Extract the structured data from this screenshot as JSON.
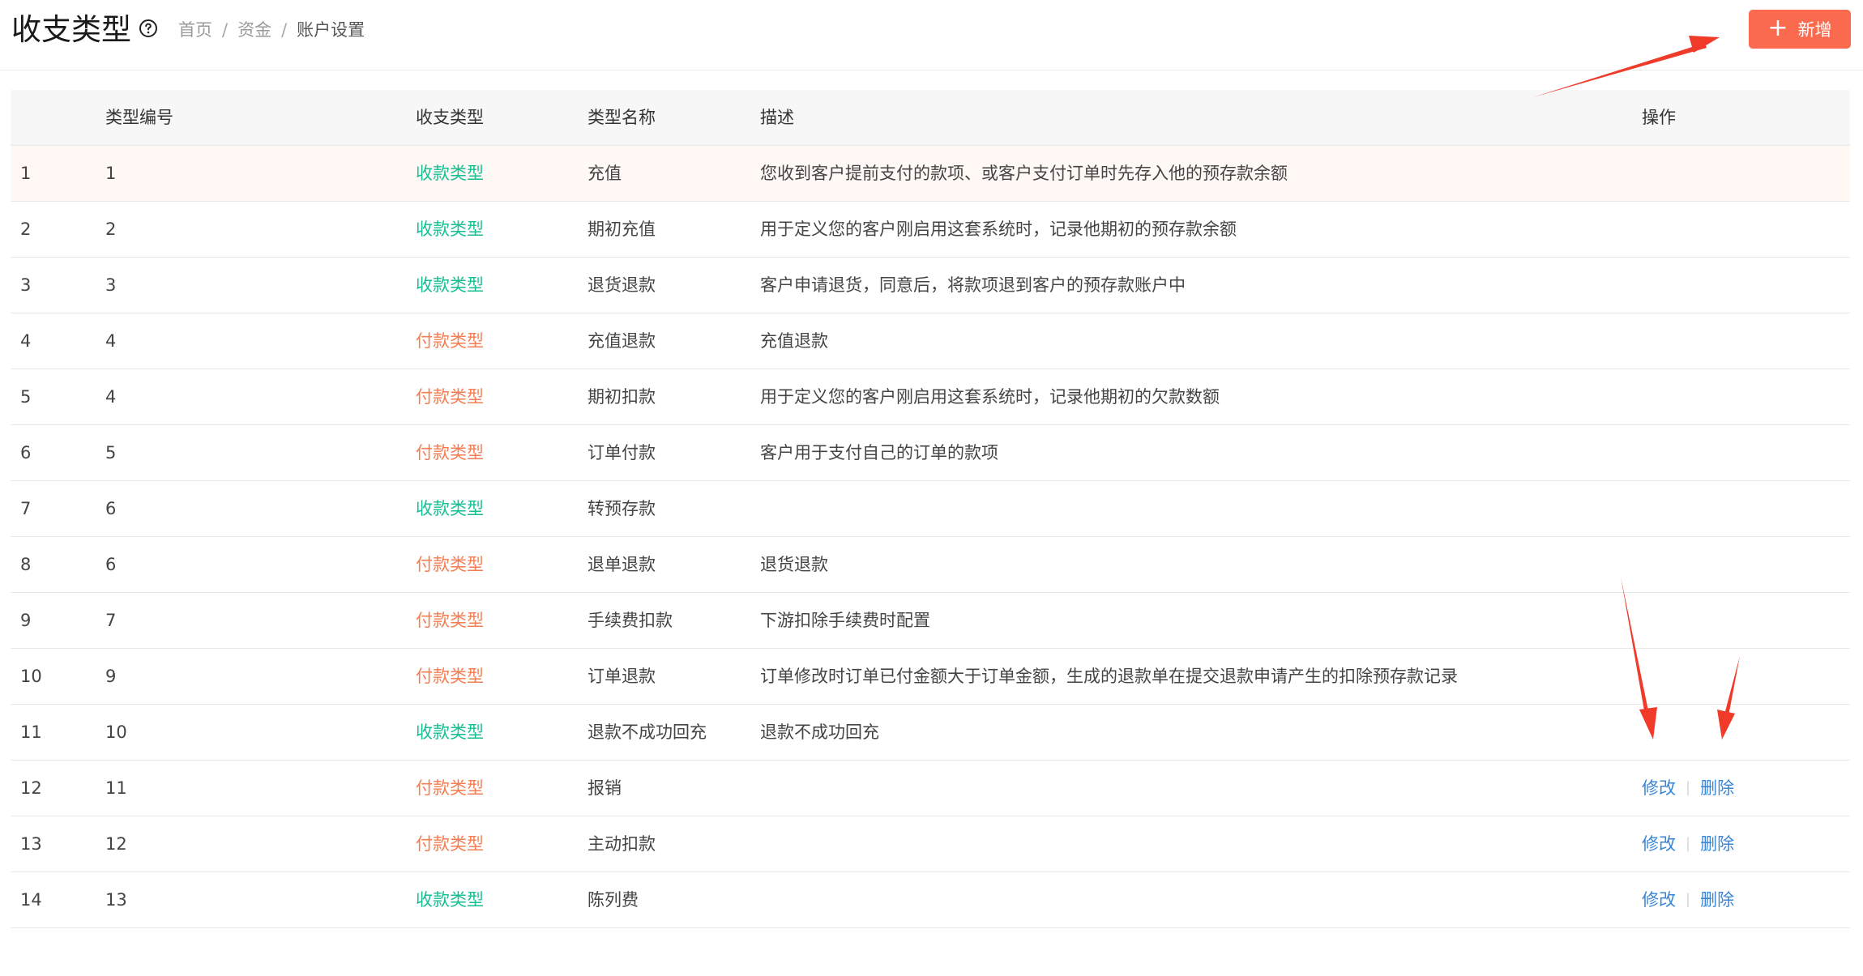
{
  "header": {
    "title": "收支类型",
    "breadcrumb": [
      "首页",
      "资金",
      "账户设置"
    ],
    "breadcrumb_separator": "/",
    "add_button_label": "新增",
    "add_button_color": "#fa6a4f"
  },
  "table": {
    "columns": [
      "",
      "类型编号",
      "收支类型",
      "类型名称",
      "描述",
      "操作"
    ],
    "rows": [
      {
        "index": "1",
        "code": "1",
        "type": "收款类型",
        "kind": "income",
        "name": "充值",
        "desc": "您收到客户提前支付的款项、或客户支付订单时先存入他的预存款余额",
        "ops": []
      },
      {
        "index": "2",
        "code": "2",
        "type": "收款类型",
        "kind": "income",
        "name": "期初充值",
        "desc": "用于定义您的客户刚启用这套系统时，记录他期初的预存款余额",
        "ops": []
      },
      {
        "index": "3",
        "code": "3",
        "type": "收款类型",
        "kind": "income",
        "name": "退货退款",
        "desc": "客户申请退货，同意后，将款项退到客户的预存款账户中",
        "ops": []
      },
      {
        "index": "4",
        "code": "4",
        "type": "付款类型",
        "kind": "payment",
        "name": "充值退款",
        "desc": "充值退款",
        "ops": []
      },
      {
        "index": "5",
        "code": "4",
        "type": "付款类型",
        "kind": "payment",
        "name": "期初扣款",
        "desc": "用于定义您的客户刚启用这套系统时，记录他期初的欠款数额",
        "ops": []
      },
      {
        "index": "6",
        "code": "5",
        "type": "付款类型",
        "kind": "payment",
        "name": "订单付款",
        "desc": "客户用于支付自己的订单的款项",
        "ops": []
      },
      {
        "index": "7",
        "code": "6",
        "type": "收款类型",
        "kind": "income",
        "name": "转预存款",
        "desc": "",
        "ops": []
      },
      {
        "index": "8",
        "code": "6",
        "type": "付款类型",
        "kind": "payment",
        "name": "退单退款",
        "desc": "退货退款",
        "ops": []
      },
      {
        "index": "9",
        "code": "7",
        "type": "付款类型",
        "kind": "payment",
        "name": "手续费扣款",
        "desc": "下游扣除手续费时配置",
        "ops": []
      },
      {
        "index": "10",
        "code": "9",
        "type": "付款类型",
        "kind": "payment",
        "name": "订单退款",
        "desc": "订单修改时订单已付金额大于订单金额，生成的退款单在提交退款申请产生的扣除预存款记录",
        "ops": []
      },
      {
        "index": "11",
        "code": "10",
        "type": "收款类型",
        "kind": "income",
        "name": "退款不成功回充",
        "desc": "退款不成功回充",
        "ops": []
      },
      {
        "index": "12",
        "code": "11",
        "type": "付款类型",
        "kind": "payment",
        "name": "报销",
        "desc": "",
        "ops": [
          "修改",
          "删除"
        ]
      },
      {
        "index": "13",
        "code": "12",
        "type": "付款类型",
        "kind": "payment",
        "name": "主动扣款",
        "desc": "",
        "ops": [
          "修改",
          "删除"
        ]
      },
      {
        "index": "14",
        "code": "13",
        "type": "收款类型",
        "kind": "income",
        "name": "陈列费",
        "desc": "",
        "ops": [
          "修改",
          "删除"
        ]
      }
    ]
  },
  "colors": {
    "income": "#16bf93",
    "payment": "#f57d52",
    "link": "#3a86d6",
    "annotation_arrow": "#f03a2a"
  },
  "icons": [
    "help-circle-icon",
    "plus-icon"
  ]
}
